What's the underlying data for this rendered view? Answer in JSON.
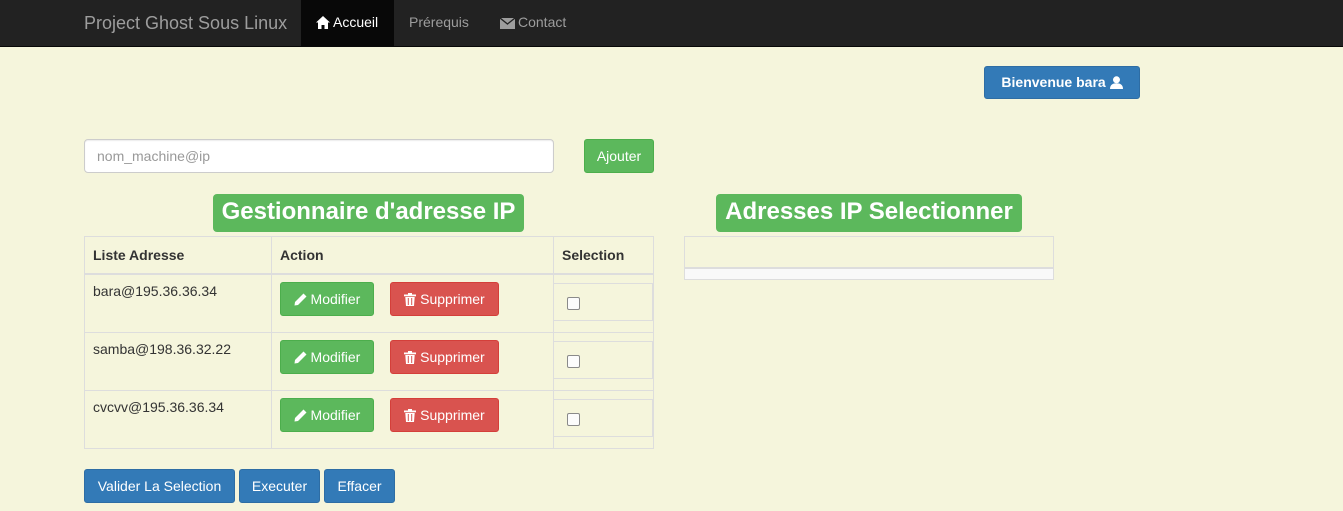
{
  "navbar": {
    "brand": "Project Ghost Sous Linux",
    "items": [
      {
        "label": "Accueil",
        "icon": "home-icon",
        "active": true
      },
      {
        "label": "Prérequis",
        "icon": null,
        "active": false
      },
      {
        "label": "Contact",
        "icon": "envelope-icon",
        "active": false
      }
    ]
  },
  "user": {
    "welcome_label": "Bienvenue bara",
    "icon": "user-icon"
  },
  "form": {
    "placeholder": "nom_machine@ip",
    "value": "",
    "add_label": "Ajouter"
  },
  "manager": {
    "title": "Gestionnaire d'adresse IP",
    "headers": {
      "address": "Liste Adresse",
      "action": "Action",
      "selection": "Selection"
    },
    "rows": [
      {
        "address": "bara@195.36.36.34",
        "modify_label": "Modifier",
        "delete_label": "Supprimer",
        "selected": false
      },
      {
        "address": "samba@198.36.32.22",
        "modify_label": "Modifier",
        "delete_label": "Supprimer",
        "selected": false
      },
      {
        "address": "cvcvv@195.36.36.34",
        "modify_label": "Modifier",
        "delete_label": "Supprimer",
        "selected": false
      }
    ]
  },
  "selected_panel": {
    "title": "Adresses IP Selectionner"
  },
  "actions": {
    "validate_label": "Valider La Selection",
    "execute_label": "Executer",
    "clear_label": "Effacer"
  },
  "colors": {
    "background": "#f5f5dc",
    "navbar": "#222222",
    "primary": "#337ab7",
    "success": "#5cb85c",
    "danger": "#d9534f"
  }
}
